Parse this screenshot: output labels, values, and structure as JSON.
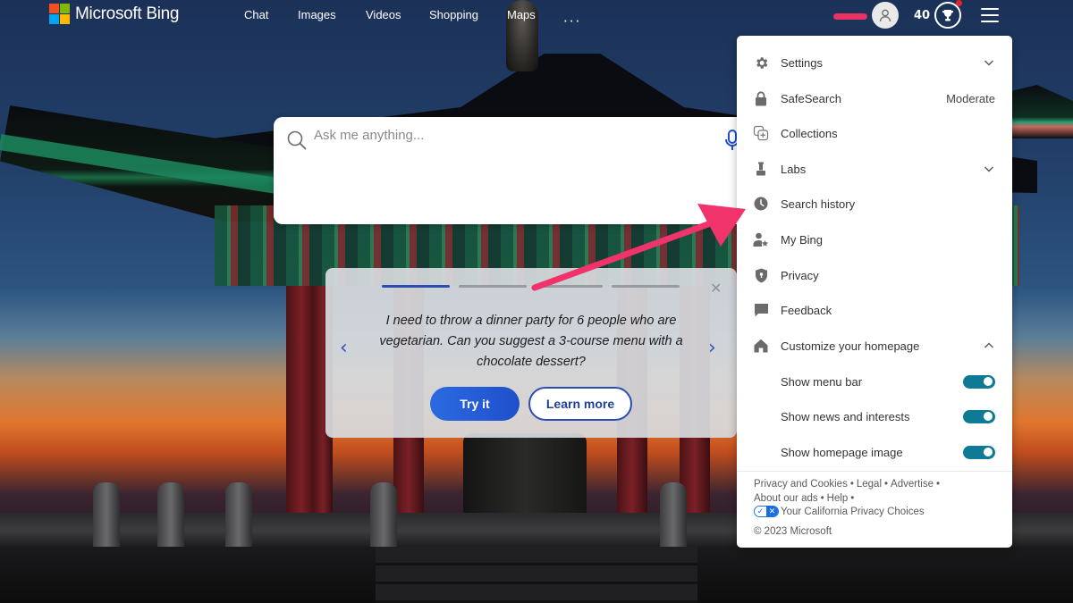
{
  "brand": {
    "name": "Microsoft Bing",
    "logo_colors": [
      "#f25022",
      "#7fba00",
      "#00a4ef",
      "#ffb900"
    ]
  },
  "nav": {
    "items": [
      {
        "label": "Chat"
      },
      {
        "label": "Images"
      },
      {
        "label": "Videos"
      },
      {
        "label": "Shopping"
      },
      {
        "label": "Maps"
      }
    ],
    "more_label": "···"
  },
  "user": {
    "rewards_points": "40"
  },
  "search": {
    "placeholder": "Ask me anything...",
    "value": ""
  },
  "suggestion_card": {
    "slides_total": 4,
    "active_slide": 1,
    "prompt": "I need to throw a dinner party for 6 people who are vegetarian. Can you suggest a 3-course menu with a chocolate dessert?",
    "try_label": "Try it",
    "learn_label": "Learn more",
    "close_glyph": "✕",
    "prev_glyph": "‹",
    "next_glyph": "›"
  },
  "menu": {
    "items": [
      {
        "label": "Settings",
        "icon": "gear-icon",
        "chevron": "down"
      },
      {
        "label": "SafeSearch",
        "icon": "lock-icon",
        "value": "Moderate"
      },
      {
        "label": "Collections",
        "icon": "collections-icon"
      },
      {
        "label": "Labs",
        "icon": "labs-icon",
        "chevron": "down"
      },
      {
        "label": "Search history",
        "icon": "clock-icon"
      },
      {
        "label": "My Bing",
        "icon": "user-star-icon"
      },
      {
        "label": "Privacy",
        "icon": "shield-icon"
      },
      {
        "label": "Feedback",
        "icon": "feedback-icon"
      },
      {
        "label": "Customize your homepage",
        "icon": "home-icon",
        "chevron": "up"
      }
    ],
    "toggles": [
      {
        "label": "Show menu bar",
        "on": true
      },
      {
        "label": "Show news and interests",
        "on": true
      },
      {
        "label": "Show homepage image",
        "on": true
      }
    ],
    "toggle_color": "#0f7a96"
  },
  "footer": {
    "links": [
      "Privacy and Cookies",
      "Legal",
      "Advertise",
      "About our ads",
      "Help"
    ],
    "privacy_choices": "Your California Privacy Choices",
    "copyright": "© 2023 Microsoft"
  },
  "annotation": {
    "arrow_color": "#f0336b",
    "points_to": "Search history"
  }
}
